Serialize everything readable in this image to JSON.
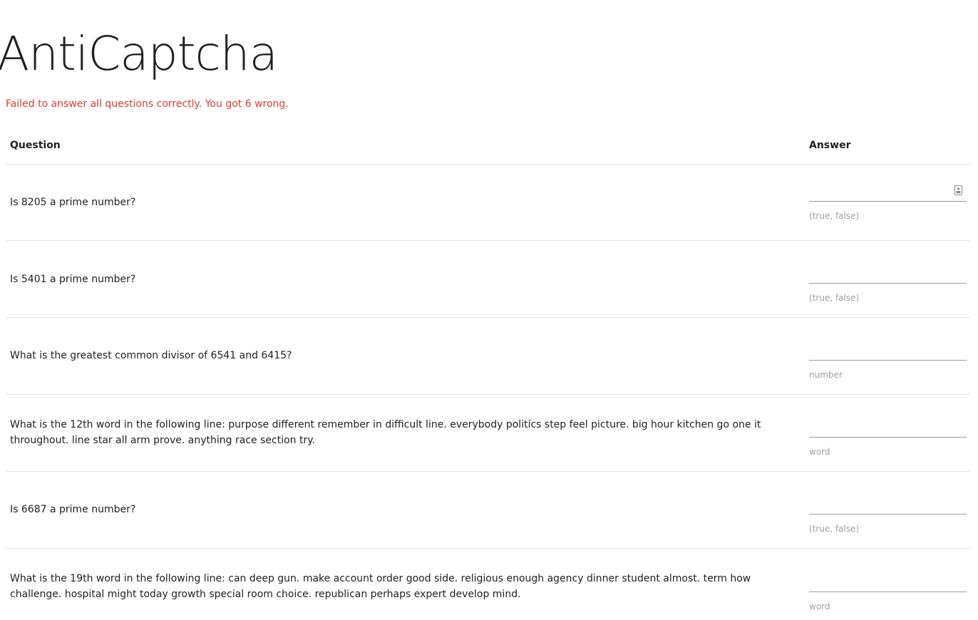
{
  "page": {
    "title": "AntiCaptcha",
    "error_message": "Failed to answer all questions correctly. You got 6 wrong."
  },
  "table": {
    "headers": {
      "question": "Question",
      "answer": "Answer"
    },
    "rows": [
      {
        "question": "Is 8205 a prime number?",
        "answer_value": "",
        "hint": "(true, false)"
      },
      {
        "question": "Is 5401 a prime number?",
        "answer_value": "",
        "hint": "(true, false)"
      },
      {
        "question": "What is the greatest common divisor of 6541 and 6415?",
        "answer_value": "",
        "hint": "number"
      },
      {
        "question": "What is the 12th word in the following line: purpose different remember in difficult line. everybody politics step feel picture. big hour kitchen go one it throughout. line star all arm prove. anything race section try.",
        "answer_value": "",
        "hint": "word"
      },
      {
        "question": "Is 6687 a prime number?",
        "answer_value": "",
        "hint": "(true, false)"
      },
      {
        "question": "What is the 19th word in the following line: can deep gun. make account order good side. religious enough agency dinner student almost. term how challenge. hospital might today growth special room choice. republican perhaps expert develop mind.",
        "answer_value": "",
        "hint": "word"
      }
    ]
  },
  "icons": {
    "autofill": "password-manager-autofill-icon"
  },
  "colors": {
    "error": "#e53935",
    "hint": "#9e9e9e",
    "divider": "#e0e0e0"
  }
}
